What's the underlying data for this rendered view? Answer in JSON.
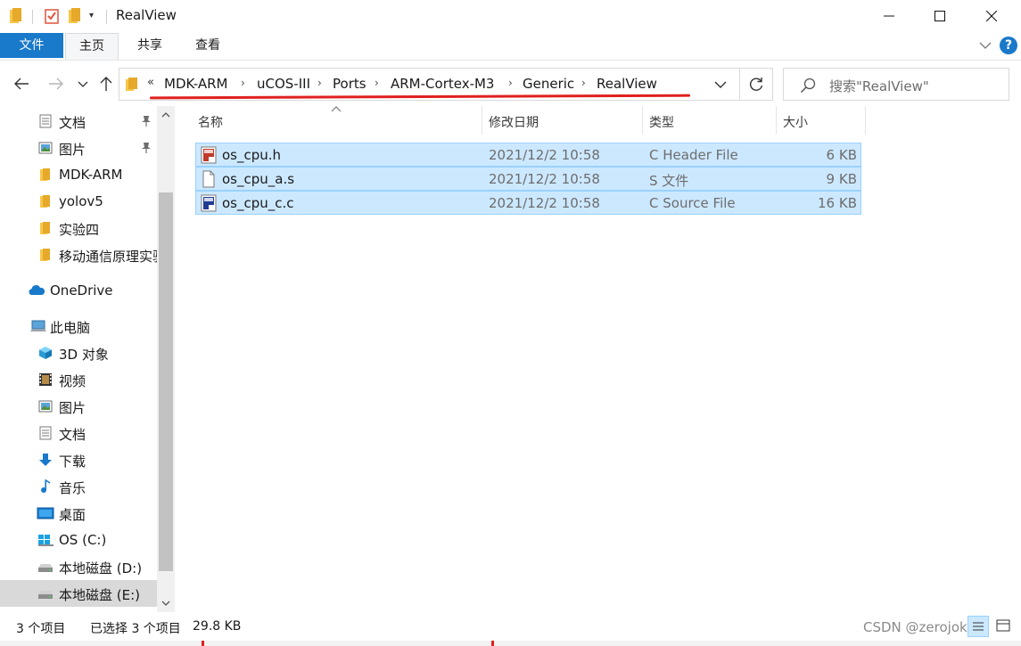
{
  "window": {
    "title": "RealView",
    "qat_dropdown": "▾"
  },
  "ribbon": {
    "tabs": [
      {
        "label": "文件"
      },
      {
        "label": "主页"
      },
      {
        "label": "共享"
      },
      {
        "label": "查看"
      }
    ]
  },
  "address": {
    "overflow": "«",
    "crumbs": [
      "MDK-ARM",
      "uCOS-III",
      "Ports",
      "ARM-Cortex-M3",
      "Generic",
      "RealView"
    ],
    "separator": "›"
  },
  "search": {
    "placeholder": "搜索\"RealView\""
  },
  "sidebar": {
    "items": [
      {
        "label": "文档",
        "icon": "document-icon"
      },
      {
        "label": "图片",
        "icon": "picture-icon"
      },
      {
        "label": "MDK-ARM",
        "icon": "folder-icon"
      },
      {
        "label": "yolov5",
        "icon": "folder-icon"
      },
      {
        "label": "实验四",
        "icon": "folder-icon"
      },
      {
        "label": "移动通信原理实验",
        "icon": "folder-icon"
      },
      {
        "label": "OneDrive",
        "icon": "cloud-icon"
      },
      {
        "label": "此电脑",
        "icon": "computer-icon"
      },
      {
        "label": "3D 对象",
        "icon": "cube-icon"
      },
      {
        "label": "视频",
        "icon": "video-icon"
      },
      {
        "label": "图片",
        "icon": "picture-icon"
      },
      {
        "label": "文档",
        "icon": "document-icon"
      },
      {
        "label": "下载",
        "icon": "download-icon"
      },
      {
        "label": "音乐",
        "icon": "music-icon"
      },
      {
        "label": "桌面",
        "icon": "desktop-icon"
      },
      {
        "label": "OS (C:)",
        "icon": "windows-drive-icon"
      },
      {
        "label": "本地磁盘 (D:)",
        "icon": "drive-icon"
      },
      {
        "label": "本地磁盘 (E:)",
        "icon": "drive-icon"
      }
    ]
  },
  "columns": {
    "name": "名称",
    "date": "修改日期",
    "type": "类型",
    "size": "大小"
  },
  "files": [
    {
      "name": "os_cpu.h",
      "date": "2021/12/2 10:58",
      "type": "C Header File",
      "size": "6 KB",
      "icon": "c-header-file-icon"
    },
    {
      "name": "os_cpu_a.s",
      "date": "2021/12/2 10:58",
      "type": "S 文件",
      "size": "9 KB",
      "icon": "blank-file-icon"
    },
    {
      "name": "os_cpu_c.c",
      "date": "2021/12/2 10:58",
      "type": "C Source File",
      "size": "16 KB",
      "icon": "c-source-file-icon"
    }
  ],
  "status": {
    "count": "3 个项目",
    "selected": "已选择 3 个项目",
    "size": "29.8 KB",
    "watermark": "CSDN @zerojoker"
  },
  "colors": {
    "accent": "#1979ca",
    "selection": "#cce8ff",
    "selection_border": "#99d1ff",
    "annotation_red": "#e0201e",
    "folder_yellow": "#f8c74a"
  }
}
